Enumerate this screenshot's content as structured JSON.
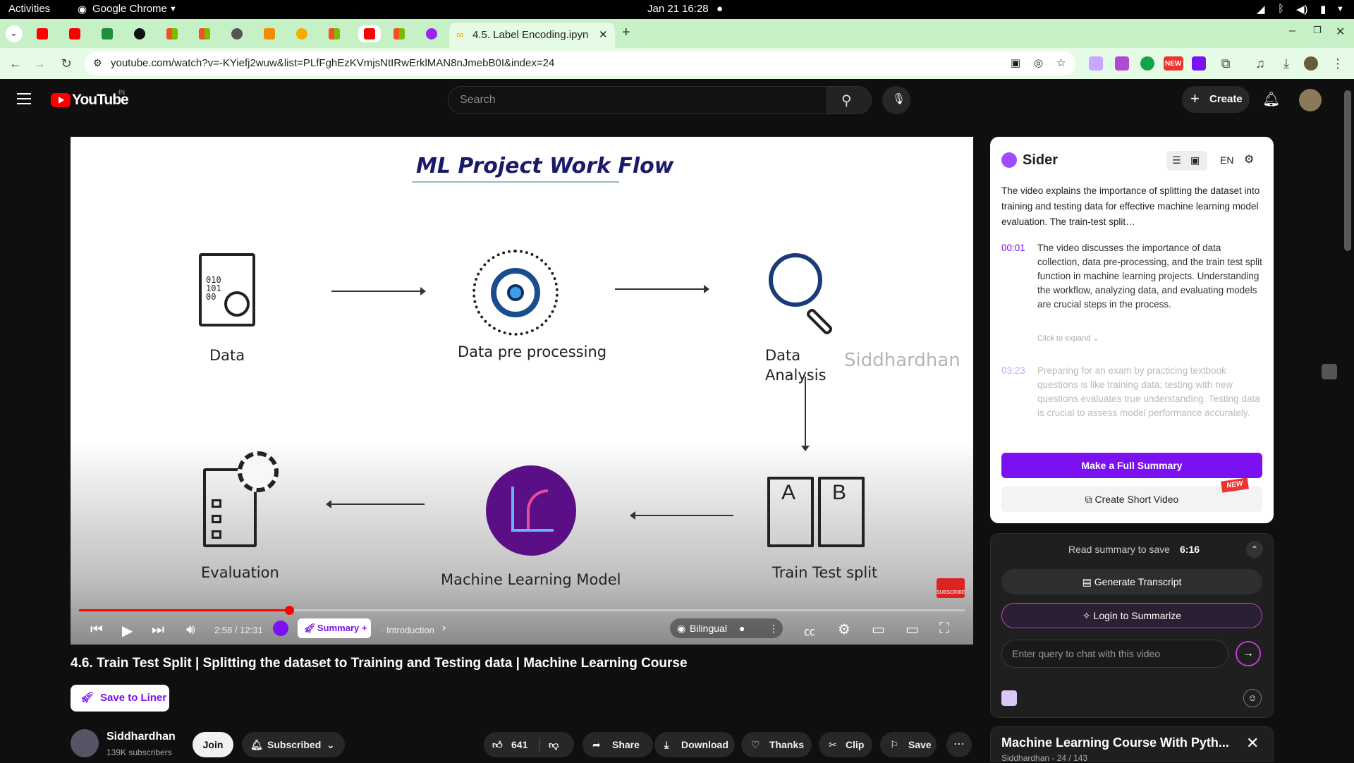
{
  "os_bar": {
    "activities": "Activities",
    "app": "Google Chrome",
    "date": "Jan 21",
    "time": "16:28"
  },
  "browser": {
    "active_tab_title": "4.5. Label Encoding.ipyn",
    "url": "youtube.com/watch?v=-KYiefj2wuw&list=PLfFghEzKVmjsNtIRwErklMAN8nJmebB0I&index=24",
    "new_badge": "NEW"
  },
  "youtube": {
    "logo": "YouTube",
    "region": "IN",
    "search_placeholder": "Search",
    "create_label": "Create"
  },
  "slide": {
    "title": "ML Project Work Flow",
    "nodes": [
      "Data",
      "Data pre processing",
      "Data",
      "Analysis",
      "Train Test split",
      "Machine Learning Model",
      "Evaluation"
    ],
    "watermark": "Siddhardhan",
    "subscribe": "SUBSCRIBE",
    "doc_letters": [
      "A",
      "B"
    ],
    "binary": [
      "010",
      "101",
      "00"
    ]
  },
  "controls": {
    "time": "2:58 / 12:31",
    "summary": "Summary +",
    "chapter": "· Introduction",
    "bilingual": "Bilingual",
    "progress": 0.237
  },
  "video": {
    "title": "4.6. Train Test Split | Splitting the dataset to Training and Testing data | Machine Learning Course",
    "save_to_liner": "Save to Liner",
    "channel": "Siddhardhan",
    "subscribers": "139K subscribers",
    "join": "Join",
    "subscribed": "Subscribed",
    "likes": "641",
    "share": "Share",
    "download": "Download",
    "thanks": "Thanks",
    "clip": "Clip",
    "save": "Save"
  },
  "sider": {
    "name": "Sider",
    "lang": "EN",
    "intro": "The video explains the importance of splitting the dataset into training and testing data for effective machine learning model evaluation. The train-test split…",
    "items": [
      {
        "time": "00:01",
        "text": "The video discusses the importance of data collection, data pre-processing, and the train test split function in machine learning projects. Understanding the workflow, analyzing data, and evaluating models are crucial steps in the process."
      },
      {
        "time": "03:23",
        "text": "Preparing for an exam by practicing textbook questions is like training data; testing with new questions evaluates true understanding. Testing data is crucial to assess model performance accurately."
      }
    ],
    "expand": "Click to expand ⌄",
    "full_summary": "Make a Full Summary",
    "short_video": "Create Short Video",
    "new_badge": "NEW",
    "read_summary": "Read summary to save",
    "save_time": "6:16",
    "transcript": "Generate Transcript",
    "login": "Login to Summarize",
    "query_placeholder": "Enter query to chat with this video"
  },
  "playlist": {
    "title": "Machine Learning Course With Pyth...",
    "sub": "Siddhardhan - 24 / 143"
  },
  "colors": {
    "accent": "#7b10f0",
    "yt_red": "#ff0000",
    "tab_green": "#c6f0c6"
  }
}
